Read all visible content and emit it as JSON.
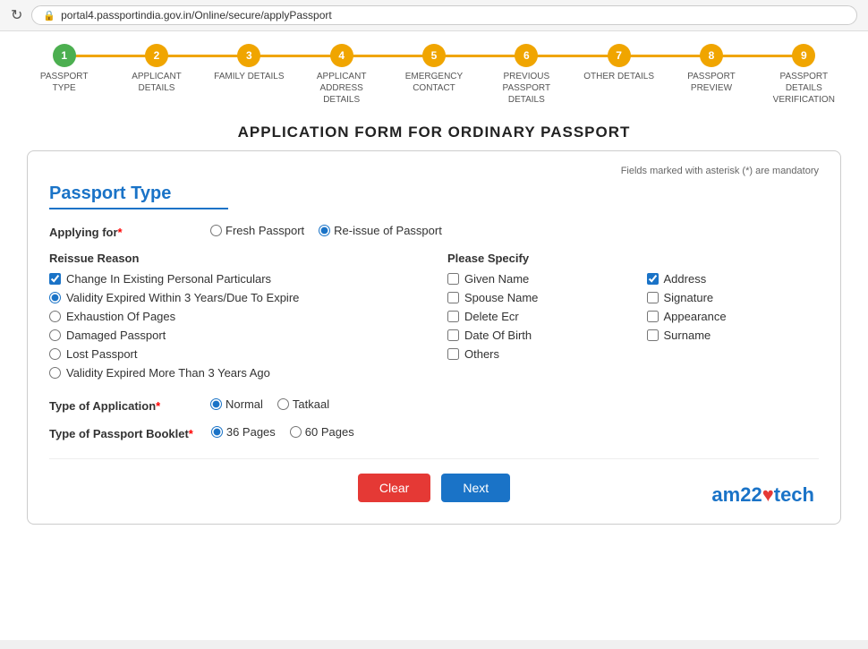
{
  "browser": {
    "url": "portal4.passportindia.gov.in/Online/secure/applyPassport",
    "reload_icon": "↻"
  },
  "progress": {
    "steps": [
      {
        "number": "1",
        "label": "PASSPORT TYPE",
        "state": "done"
      },
      {
        "number": "2",
        "label": "APPLICANT DETAILS",
        "state": "active"
      },
      {
        "number": "3",
        "label": "FAMILY DETAILS",
        "state": "active"
      },
      {
        "number": "4",
        "label": "APPLICANT ADDRESS DETAILS",
        "state": "active"
      },
      {
        "number": "5",
        "label": "EMERGENCY CONTACT",
        "state": "active"
      },
      {
        "number": "6",
        "label": "PREVIOUS PASSPORT DETAILS",
        "state": "active"
      },
      {
        "number": "7",
        "label": "OTHER DETAILS",
        "state": "active"
      },
      {
        "number": "8",
        "label": "PASSPORT PREVIEW",
        "state": "active"
      },
      {
        "number": "9",
        "label": "PASSPORT DETAILS VERIFICATION",
        "state": "active"
      }
    ]
  },
  "page_title": "APPLICATION FORM FOR ORDINARY PASSPORT",
  "form": {
    "mandatory_note": "Fields marked with asterisk (*) are mandatory",
    "section_title": "Passport Type",
    "applying_for_label": "Applying for",
    "applying_for_required": "*",
    "fresh_passport": "Fresh Passport",
    "reissue_passport": "Re-issue of Passport",
    "reissue_reason_label": "Reissue Reason",
    "reissue_options": [
      {
        "label": "Change In Existing Personal Particulars",
        "type": "checkbox",
        "checked": true
      },
      {
        "label": "Validity Expired Within 3 Years/Due To Expire",
        "type": "radio",
        "checked": true
      },
      {
        "label": "Exhaustion Of Pages",
        "type": "radio",
        "checked": false
      },
      {
        "label": "Damaged Passport",
        "type": "radio",
        "checked": false
      },
      {
        "label": "Lost Passport",
        "type": "radio",
        "checked": false
      },
      {
        "label": "Validity Expired More Than 3 Years Ago",
        "type": "radio",
        "checked": false
      }
    ],
    "please_specify_label": "Please Specify",
    "specify_col1": [
      {
        "label": "Given Name",
        "checked": false
      },
      {
        "label": "Spouse Name",
        "checked": false
      },
      {
        "label": "Delete Ecr",
        "checked": false
      },
      {
        "label": "Date Of Birth",
        "checked": false
      },
      {
        "label": "Others",
        "checked": false
      }
    ],
    "specify_col2": [
      {
        "label": "Address",
        "checked": true
      },
      {
        "label": "Signature",
        "checked": false
      },
      {
        "label": "Appearance",
        "checked": false
      },
      {
        "label": "Surname",
        "checked": false
      }
    ],
    "type_of_application_label": "Type of Application",
    "type_of_application_required": "*",
    "application_options": [
      {
        "label": "Normal",
        "checked": true
      },
      {
        "label": "Tatkaal",
        "checked": false
      }
    ],
    "type_of_booklet_label": "Type of Passport Booklet",
    "type_of_booklet_required": "*",
    "booklet_options": [
      {
        "label": "36 Pages",
        "checked": true
      },
      {
        "label": "60 Pages",
        "checked": false
      }
    ],
    "btn_clear": "Clear",
    "btn_next": "Next"
  }
}
